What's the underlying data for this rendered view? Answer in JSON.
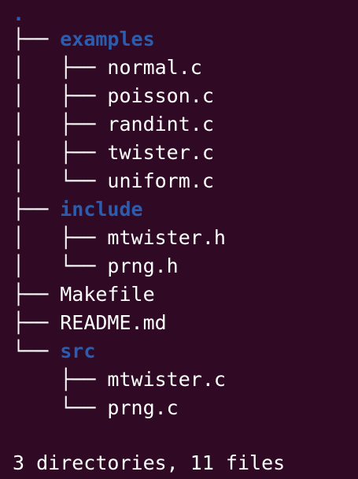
{
  "colors": {
    "background": "#300a24",
    "directory": "#2a5db0",
    "file": "#ffffff"
  },
  "tree": {
    "root": ".",
    "rows": [
      {
        "prefix": "├── ",
        "name": "examples",
        "kind": "dir"
      },
      {
        "prefix": "│   ├── ",
        "name": "normal.c",
        "kind": "file"
      },
      {
        "prefix": "│   ├── ",
        "name": "poisson.c",
        "kind": "file"
      },
      {
        "prefix": "│   ├── ",
        "name": "randint.c",
        "kind": "file"
      },
      {
        "prefix": "│   ├── ",
        "name": "twister.c",
        "kind": "file"
      },
      {
        "prefix": "│   └── ",
        "name": "uniform.c",
        "kind": "file"
      },
      {
        "prefix": "├── ",
        "name": "include",
        "kind": "dir"
      },
      {
        "prefix": "│   ├── ",
        "name": "mtwister.h",
        "kind": "file"
      },
      {
        "prefix": "│   └── ",
        "name": "prng.h",
        "kind": "file"
      },
      {
        "prefix": "├── ",
        "name": "Makefile",
        "kind": "file"
      },
      {
        "prefix": "├── ",
        "name": "README.md",
        "kind": "file"
      },
      {
        "prefix": "└── ",
        "name": "src",
        "kind": "dir"
      },
      {
        "prefix": "    ├── ",
        "name": "mtwister.c",
        "kind": "file"
      },
      {
        "prefix": "    └── ",
        "name": "prng.c",
        "kind": "file"
      }
    ]
  },
  "summary": "3 directories, 11 files"
}
